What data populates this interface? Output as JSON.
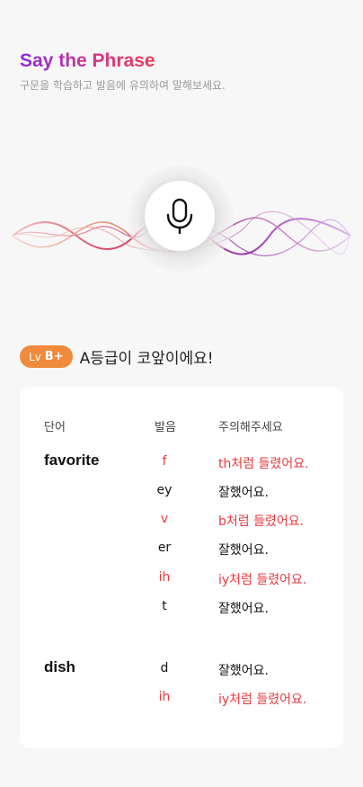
{
  "header": {
    "title": "Say the Phrase",
    "subtitle": "구문을 학습하고 발음에 유의하여 말해보세요."
  },
  "mic": {
    "icon": "microphone-icon"
  },
  "level": {
    "lv_label": "Lv",
    "grade": "B+",
    "message": "A등급이 코앞이에요!",
    "badge_color": "#f08a3c"
  },
  "table": {
    "headers": {
      "word": "단어",
      "pronunciation": "발음",
      "feedback": "주의해주세요"
    },
    "rows": [
      {
        "word": "favorite",
        "phoneme": "f",
        "feedback": "th처럼 들렸어요.",
        "status": "bad"
      },
      {
        "word": "",
        "phoneme": "ey",
        "feedback": "잘했어요.",
        "status": "good"
      },
      {
        "word": "",
        "phoneme": "v",
        "feedback": "b처럼 들렸어요.",
        "status": "bad"
      },
      {
        "word": "",
        "phoneme": "er",
        "feedback": "잘했어요.",
        "status": "good"
      },
      {
        "word": "",
        "phoneme": "ih",
        "feedback": "iy처럼 들렸어요.",
        "status": "bad"
      },
      {
        "word": "",
        "phoneme": "t",
        "feedback": "잘했어요.",
        "status": "good"
      },
      {
        "word": "dish",
        "phoneme": "d",
        "feedback": "잘했어요.",
        "status": "good"
      },
      {
        "word": "",
        "phoneme": "ih",
        "feedback": "iy처럼 들렸어요.",
        "status": "bad"
      }
    ]
  },
  "colors": {
    "error": "#e8383d",
    "ok": "#111111",
    "title_start": "#8b2be2",
    "title_end": "#ef3b5a"
  }
}
